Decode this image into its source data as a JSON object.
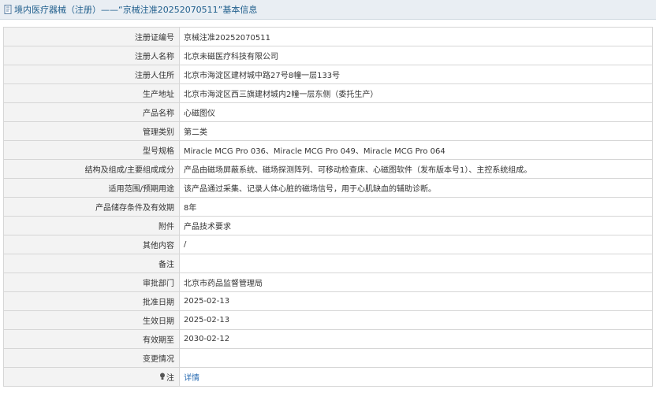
{
  "header": {
    "title": "境内医疗器械（注册）——“京械注准20252070511”基本信息",
    "icon": "document-icon"
  },
  "rows": [
    {
      "label": "注册证编号",
      "value": "京械注准20252070511"
    },
    {
      "label": "注册人名称",
      "value": "北京未磁医疗科技有限公司"
    },
    {
      "label": "注册人住所",
      "value": "北京市海淀区建材城中路27号8幢一层133号"
    },
    {
      "label": "生产地址",
      "value": "北京市海淀区西三旗建材城内2幢一层东侧（委托生产）"
    },
    {
      "label": "产品名称",
      "value": "心磁图仪"
    },
    {
      "label": "管理类别",
      "value": "第二类"
    },
    {
      "label": "型号规格",
      "value": "Miracle MCG Pro 036、Miracle MCG Pro 049、Miracle MCG Pro 064"
    },
    {
      "label": "结构及组成/主要组成成分",
      "value": "产品由磁场屏蔽系统、磁场探测阵列、可移动检查床、心磁图软件（发布版本号1）、主控系统组成。"
    },
    {
      "label": "适用范围/预期用途",
      "value": "该产品通过采集、记录人体心脏的磁场信号，用于心肌缺血的辅助诊断。"
    },
    {
      "label": "产品储存条件及有效期",
      "value": "8年"
    },
    {
      "label": "附件",
      "value": "产品技术要求"
    },
    {
      "label": "其他内容",
      "value": "/"
    },
    {
      "label": "备注",
      "value": ""
    },
    {
      "label": "审批部门",
      "value": "北京市药品监督管理局"
    },
    {
      "label": "批准日期",
      "value": "2025-02-13"
    },
    {
      "label": "生效日期",
      "value": "2025-02-13"
    },
    {
      "label": "有效期至",
      "value": "2030-02-12"
    },
    {
      "label": "变更情况",
      "value": ""
    }
  ],
  "note_row": {
    "label": "注",
    "icon": "info-bulb-icon",
    "link_text": "详情"
  }
}
